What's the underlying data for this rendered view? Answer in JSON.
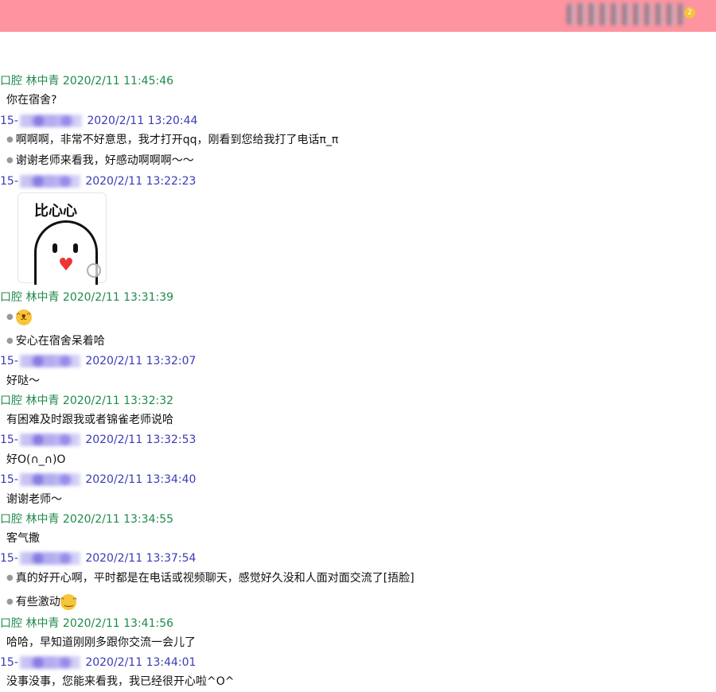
{
  "colors": {
    "topbar": "#fd94a0",
    "teacher_header": "#1f8a4c",
    "student_header": "#3b3bb8"
  },
  "header_bar": {
    "badge": "2"
  },
  "conversation": [
    {
      "sender": "口腔 林中青",
      "time": "2020/2/11 11:45:46",
      "role": "teacher",
      "messages": [
        {
          "text": "你在宿舍?",
          "bullet": false
        }
      ]
    },
    {
      "sender": "15-",
      "time": "2020/2/11 13:20:44",
      "role": "student",
      "messages": [
        {
          "text": "啊啊啊，非常不好意思，我才打开qq，刚看到您给我打了电话π_π",
          "bullet": true
        },
        {
          "text": "谢谢老师来看我，好感动啊啊啊～～",
          "bullet": true
        }
      ]
    },
    {
      "sender": "15-",
      "time": "2020/2/11 13:22:23",
      "role": "student",
      "sticker": {
        "caption": "比心心",
        "icon": "zoom-icon"
      }
    },
    {
      "sender": "口腔 林中青",
      "time": "2020/2/11 13:31:39",
      "role": "teacher",
      "messages": [
        {
          "emoji": "grin-emoji",
          "bullet": true
        },
        {
          "text": "安心在宿舍呆着哈",
          "bullet": true
        }
      ]
    },
    {
      "sender": "15-",
      "time": "2020/2/11 13:32:07",
      "role": "student",
      "messages": [
        {
          "text": "好哒～",
          "bullet": false
        }
      ]
    },
    {
      "sender": "口腔 林中青",
      "time": "2020/2/11 13:32:32",
      "role": "teacher",
      "messages": [
        {
          "text": "有困难及时跟我或者锦雀老师说哈",
          "bullet": false
        }
      ]
    },
    {
      "sender": "15-",
      "time": "2020/2/11 13:32:53",
      "role": "student",
      "messages": [
        {
          "text": "好O(∩_∩)O",
          "bullet": false
        }
      ]
    },
    {
      "sender": "15-",
      "time": "2020/2/11 13:34:40",
      "role": "student",
      "messages": [
        {
          "text": "谢谢老师～",
          "bullet": false
        }
      ]
    },
    {
      "sender": "口腔 林中青",
      "time": "2020/2/11 13:34:55",
      "role": "teacher",
      "messages": [
        {
          "text": "客气撒",
          "bullet": false
        }
      ]
    },
    {
      "sender": "15-",
      "time": "2020/2/11 13:37:54",
      "role": "student",
      "messages": [
        {
          "text": "真的好开心啊，平时都是在电话或视频聊天，感觉好久没和人面对面交流了[捂脸]",
          "bullet": true
        },
        {
          "text": "有些激动",
          "emoji": "laugh-cry-emoji",
          "bullet": true
        }
      ]
    },
    {
      "sender": "口腔 林中青",
      "time": "2020/2/11 13:41:56",
      "role": "teacher",
      "messages": [
        {
          "text": "哈哈，早知道刚刚多跟你交流一会儿了",
          "bullet": false
        }
      ]
    },
    {
      "sender": "15-",
      "time": "2020/2/11 13:44:01",
      "role": "student",
      "messages": [
        {
          "text": "没事没事，您能来看我，我已经很开心啦^O^",
          "bullet": false
        }
      ]
    }
  ]
}
